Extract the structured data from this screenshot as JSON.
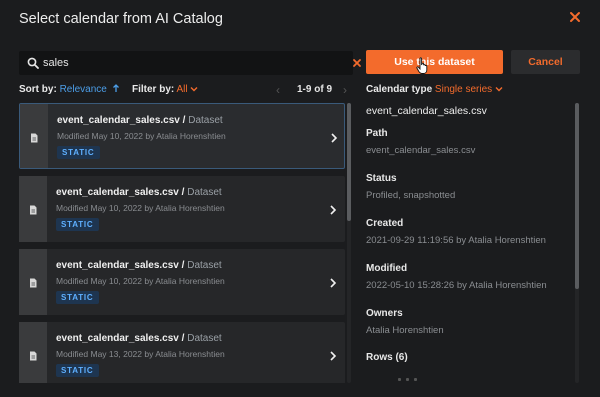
{
  "dialog": {
    "title": "Select calendar from AI Catalog"
  },
  "search": {
    "value": "sales",
    "placeholder": ""
  },
  "sort": {
    "label": "Sort by:",
    "value": "Relevance"
  },
  "filter": {
    "label": "Filter by:",
    "value": "All"
  },
  "pager": {
    "text": "1-9 of 9"
  },
  "items": [
    {
      "name": "event_calendar_sales.csv",
      "sep": " / ",
      "type": "Dataset",
      "meta": "Modified May 10, 2022 by Atalia Horenshtien",
      "badge": "STATIC"
    },
    {
      "name": "event_calendar_sales.csv",
      "sep": " / ",
      "type": "Dataset",
      "meta": "Modified May 10, 2022 by Atalia Horenshtien",
      "badge": "STATIC"
    },
    {
      "name": "event_calendar_sales.csv",
      "sep": " / ",
      "type": "Dataset",
      "meta": "Modified May 10, 2022 by Atalia Horenshtien",
      "badge": "STATIC"
    },
    {
      "name": "event_calendar_sales.csv",
      "sep": " / ",
      "type": "Dataset",
      "meta": "Modified May 13, 2022 by Atalia Horenshtien",
      "badge": "STATIC"
    }
  ],
  "actions": {
    "use_label": "Use this dataset",
    "cancel_label": "Cancel"
  },
  "calendar_type": {
    "label": "Calendar type",
    "value": "Single series"
  },
  "detail": {
    "title": "event_calendar_sales.csv",
    "fields": [
      {
        "label": "Path",
        "value": "event_calendar_sales.csv"
      },
      {
        "label": "Status",
        "value": "Profiled, snapshotted"
      },
      {
        "label": "Created",
        "value": "2021-09-29 11:19:56 by Atalia Horenshtien"
      },
      {
        "label": "Modified",
        "value": "2022-05-10 15:28:26 by Atalia Horenshtien"
      },
      {
        "label": "Owners",
        "value": "Atalia Horenshtien"
      },
      {
        "label": "Rows (6)",
        "value": ""
      }
    ]
  },
  "colors": {
    "accent": "#f36b2c",
    "link": "#4c9ee8",
    "background": "#1b1c1e"
  },
  "icons": {
    "close": "close-icon",
    "search": "search-icon",
    "clear": "clear-icon",
    "file": "file-icon",
    "chevron": "chevron-right-icon"
  }
}
